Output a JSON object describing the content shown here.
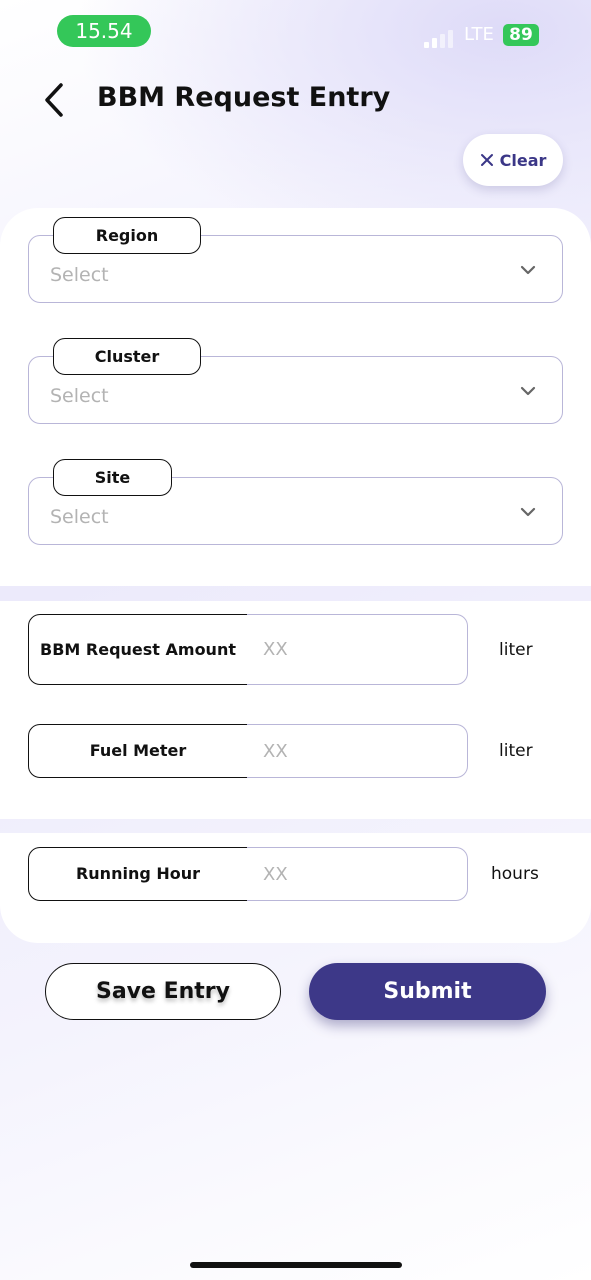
{
  "status_bar": {
    "time": "15.54",
    "network": "LTE",
    "battery": "89"
  },
  "header": {
    "title": "BBM Request Entry",
    "clear_label": "Clear"
  },
  "selects": [
    {
      "label": "Region",
      "placeholder": "Select"
    },
    {
      "label": "Cluster",
      "placeholder": "Select"
    },
    {
      "label": "Site",
      "placeholder": "Select"
    }
  ],
  "inputs": [
    {
      "label": "BBM Request Amount",
      "placeholder": "XX",
      "unit": "liter"
    },
    {
      "label": "Fuel Meter",
      "placeholder": "XX",
      "unit": "liter"
    },
    {
      "label": "Running Hour",
      "placeholder": "XX",
      "unit": "hours"
    }
  ],
  "actions": {
    "save_label": "Save Entry",
    "submit_label": "Submit"
  },
  "colors": {
    "accent": "#3d3888",
    "status_green": "#34c759",
    "field_border": "#b9b6d8",
    "placeholder": "#b3b3b3"
  },
  "icons": {
    "back": "chevron-left-icon",
    "clear": "close-icon",
    "dropdown": "chevron-down-icon"
  }
}
